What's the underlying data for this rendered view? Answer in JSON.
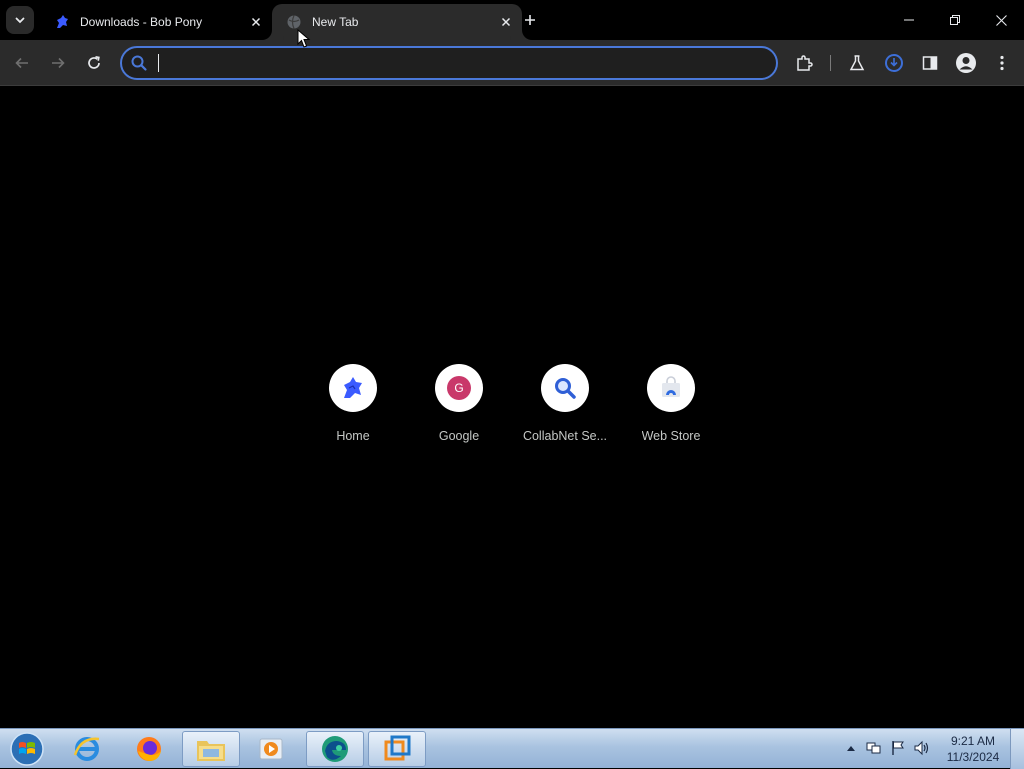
{
  "browser": {
    "tabs": [
      {
        "title": "Downloads - Bob Pony",
        "active": false
      },
      {
        "title": "New Tab",
        "active": true
      }
    ],
    "omnibox": {
      "value": "",
      "placeholder": ""
    },
    "accent_color": "#4a78d8"
  },
  "new_tab_page": {
    "shortcuts": [
      {
        "label": "Home",
        "icon": "bob-pony-logo"
      },
      {
        "label": "Google",
        "icon": "google-g-letter"
      },
      {
        "label": "CollabNet Se...",
        "icon": "magnifier"
      },
      {
        "label": "Web Store",
        "icon": "web-store-bag"
      }
    ],
    "google_letter": "G"
  },
  "taskbar": {
    "pinned": [
      "start",
      "internet-explorer",
      "firefox",
      "file-explorer",
      "media-player",
      "edge",
      "vmware"
    ],
    "clock": {
      "time": "9:21 AM",
      "date": "11/3/2024"
    }
  }
}
